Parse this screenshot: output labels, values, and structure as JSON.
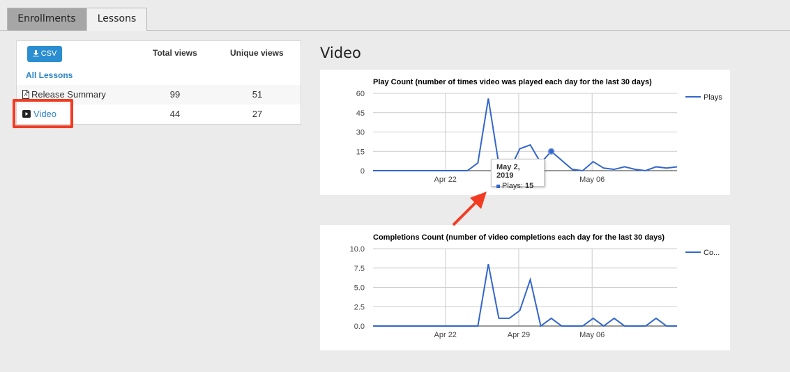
{
  "tabs": [
    {
      "label": "Enrollments",
      "active": true
    },
    {
      "label": "Lessons",
      "active": false
    }
  ],
  "table": {
    "csv_label": "CSV",
    "headers": {
      "total": "Total views",
      "unique": "Unique views"
    },
    "all_lessons": "All Lessons",
    "rows": [
      {
        "name": "Release Summary",
        "icon": "pdf-file-icon",
        "total": "99",
        "unique": "51"
      },
      {
        "name": "Video",
        "icon": "video-play-icon",
        "total": "44",
        "unique": "27"
      }
    ]
  },
  "section_title": "Video",
  "tooltip": {
    "date": "May 2, 2019",
    "label": "Plays:",
    "value": "15"
  },
  "colors": {
    "series": "#3366cc",
    "link": "#2a84c8",
    "csv_button": "#2a8ed1",
    "highlight": "#f23b22"
  },
  "chart_data": [
    {
      "type": "line",
      "title": "Play Count (number of times video was played each day for the last 30 days)",
      "xlabel": "",
      "ylabel": "",
      "ylim": [
        0,
        60
      ],
      "yticks": [
        "0",
        "15",
        "30",
        "45",
        "60"
      ],
      "x_tick_labels": [
        "Apr 22",
        "",
        "May 06"
      ],
      "x": [
        1,
        2,
        3,
        4,
        5,
        6,
        7,
        8,
        9,
        10,
        11,
        12,
        13,
        14,
        15,
        16,
        17,
        18,
        19,
        20,
        21,
        22,
        23,
        24,
        25,
        26,
        27,
        28,
        29,
        30
      ],
      "series": [
        {
          "name": "Plays",
          "values": [
            0,
            0,
            0,
            0,
            0,
            0,
            0,
            0,
            0,
            0,
            6,
            56,
            5,
            0,
            17,
            20,
            6,
            15,
            8,
            1,
            0,
            7,
            2,
            1,
            3,
            1,
            0,
            3,
            2,
            3
          ]
        }
      ],
      "legend": "right",
      "grid": true
    },
    {
      "type": "line",
      "title": "Completions Count (number of video completions each day for the last 30 days)",
      "xlabel": "",
      "ylabel": "",
      "ylim": [
        0,
        10
      ],
      "yticks": [
        "0.0",
        "2.5",
        "5.0",
        "7.5",
        "10.0"
      ],
      "x_tick_labels": [
        "Apr 22",
        "Apr 29",
        "May 06"
      ],
      "x": [
        1,
        2,
        3,
        4,
        5,
        6,
        7,
        8,
        9,
        10,
        11,
        12,
        13,
        14,
        15,
        16,
        17,
        18,
        19,
        20,
        21,
        22,
        23,
        24,
        25,
        26,
        27,
        28,
        29,
        30
      ],
      "series": [
        {
          "name": "Co...",
          "values": [
            0,
            0,
            0,
            0,
            0,
            0,
            0,
            0,
            0,
            0,
            0,
            8,
            1,
            1,
            2,
            6,
            0,
            1,
            0,
            0,
            0,
            1,
            0,
            1,
            0,
            0,
            0,
            1,
            0,
            0
          ]
        }
      ],
      "legend": "right",
      "grid": true
    }
  ]
}
